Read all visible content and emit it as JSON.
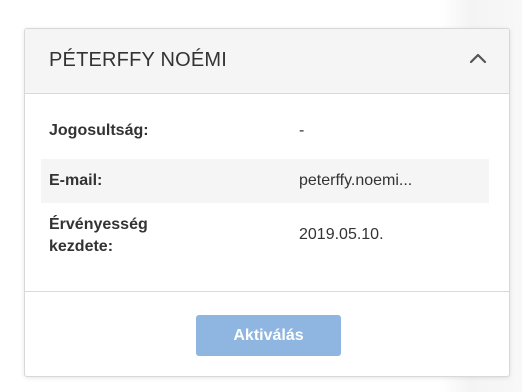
{
  "panel": {
    "title": "PÉTERFFY NOÉMI",
    "collapse_icon": "chevron-up-icon"
  },
  "details": [
    {
      "label": "Jogosultság:",
      "value": "-"
    },
    {
      "label": "E-mail:",
      "value": "peterffy.noemi..."
    },
    {
      "label": "Érvényesség kezdete:",
      "value": "2019.05.10."
    }
  ],
  "footer": {
    "activate_label": "Aktiválás"
  },
  "colors": {
    "accent_button": "#8fb6e0",
    "header_bg": "#f5f5f5",
    "text": "#333333"
  }
}
